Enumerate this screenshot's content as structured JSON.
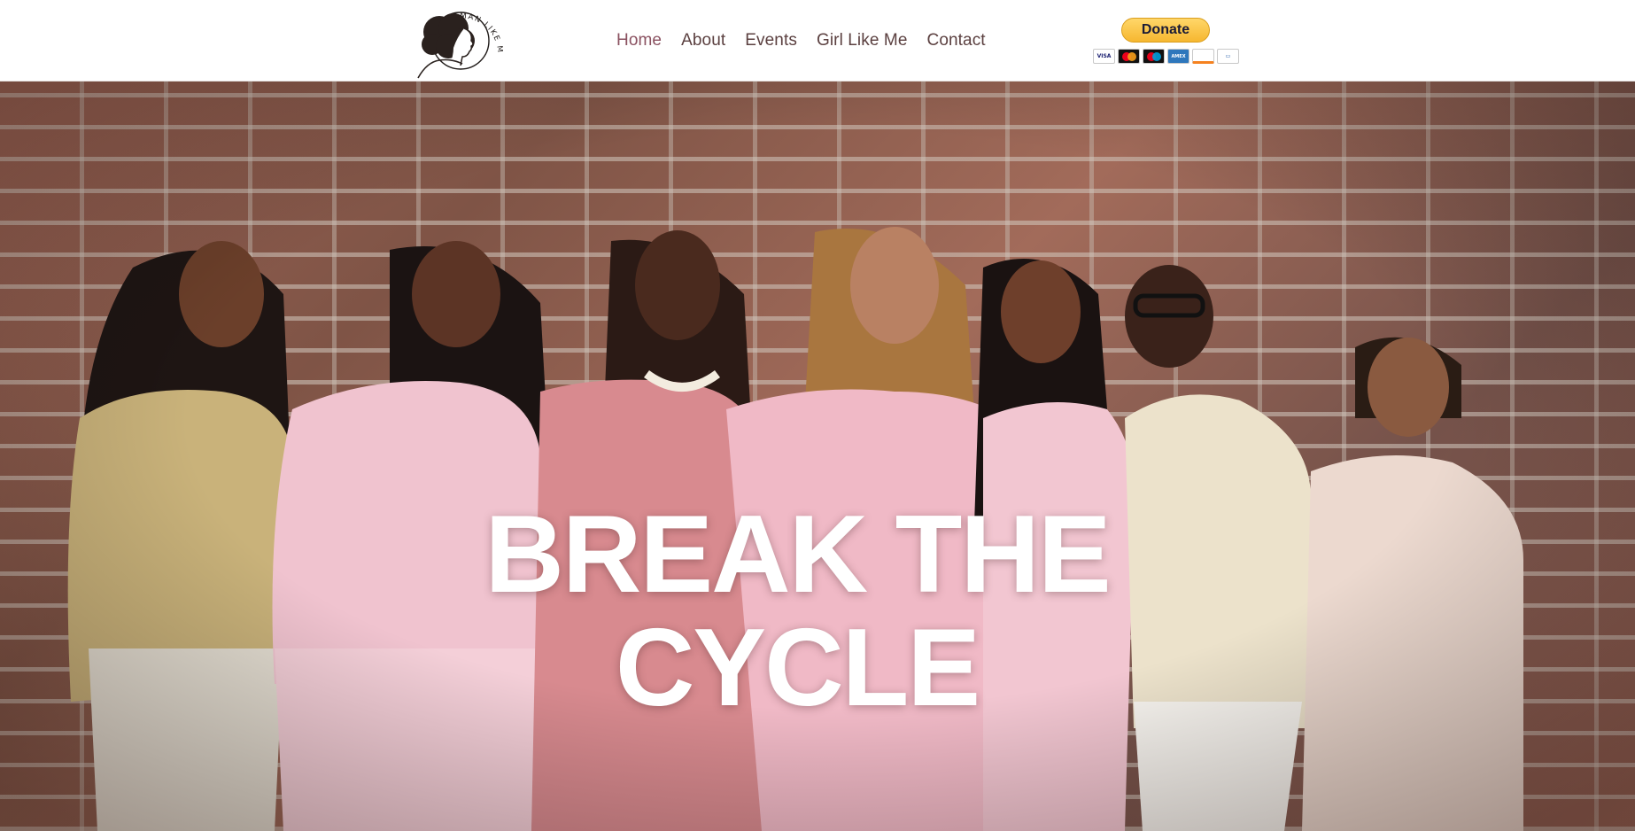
{
  "header": {
    "logo": {
      "text": "WOMAN LIKE ME",
      "icon": "afro-silhouette-logo-icon"
    },
    "nav": {
      "items": [
        {
          "label": "Home",
          "active": true
        },
        {
          "label": "About",
          "active": false
        },
        {
          "label": "Events",
          "active": false
        },
        {
          "label": "Girl Like Me",
          "active": false
        },
        {
          "label": "Contact",
          "active": false
        }
      ]
    },
    "donate": {
      "label": "Donate",
      "cards": [
        "VISA",
        "Mastercard",
        "Maestro",
        "AMEX",
        "DISCOVER",
        "eCheck"
      ]
    }
  },
  "hero": {
    "title_line1": "BREAK THE",
    "title_line2": "CYCLE",
    "image": "group-photo-seven-women-brick-wall"
  },
  "colors": {
    "nav_text": "#5b4040",
    "nav_active": "#8a5160",
    "donate_button": "#f6b730",
    "hero_title": "#ffffff"
  }
}
